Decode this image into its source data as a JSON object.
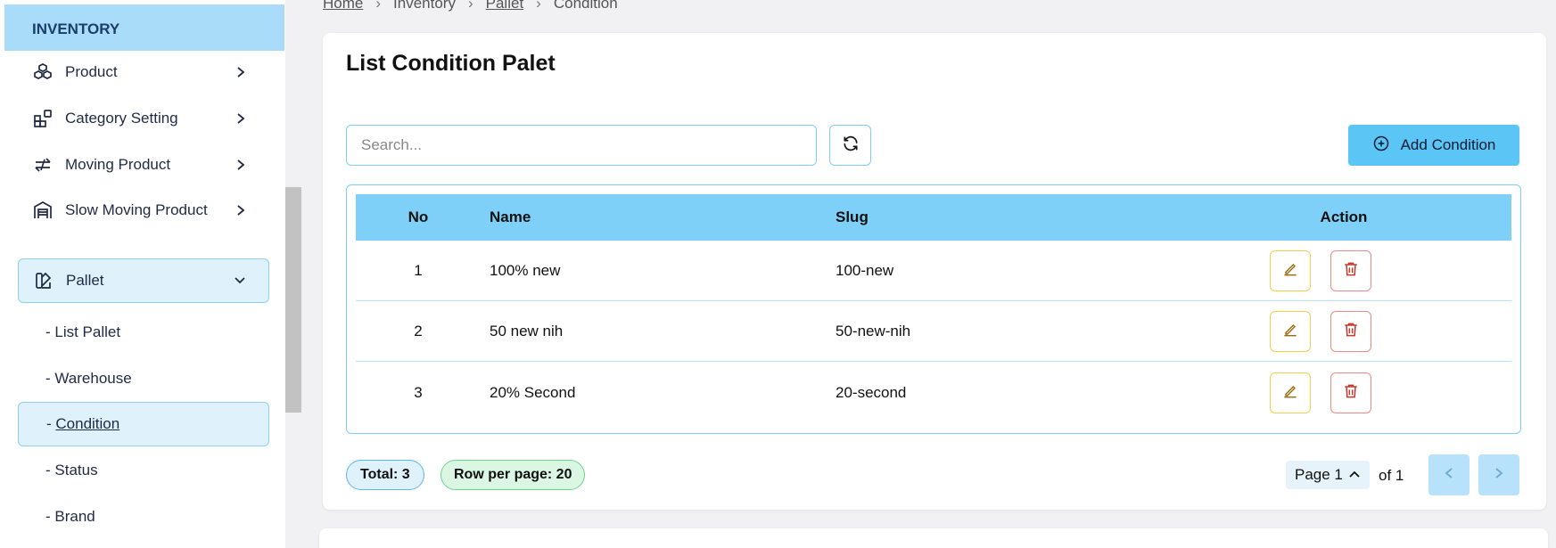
{
  "sidebar": {
    "section_title": "INVENTORY",
    "items": [
      {
        "label": "Product",
        "icon": "boxes-icon",
        "chevron": "chevron-right"
      },
      {
        "label": "Category Setting",
        "icon": "category-grid-icon",
        "chevron": "chevron-right"
      },
      {
        "label": "Moving Product",
        "icon": "arrows-exchange-icon",
        "chevron": "chevron-right"
      },
      {
        "label": "Slow Moving Product",
        "icon": "warehouse-icon",
        "chevron": "chevron-right"
      },
      {
        "label": "Pallet",
        "icon": "pallet-icon",
        "chevron": "chevron-down",
        "active": true
      }
    ],
    "subitems": [
      {
        "label": "- List Pallet"
      },
      {
        "label": "- Warehouse"
      },
      {
        "label": "Condition",
        "prefix": "- ",
        "active": true
      },
      {
        "label": "- Status"
      },
      {
        "label": "- Brand"
      }
    ]
  },
  "breadcrumb": [
    "Home",
    "Inventory",
    "Pallet",
    "Condition"
  ],
  "page": {
    "title": "List Condition Palet",
    "search_placeholder": "Search...",
    "add_button_label": "Add Condition"
  },
  "table": {
    "headers": {
      "no": "No",
      "name": "Name",
      "slug": "Slug",
      "action": "Action"
    },
    "rows": [
      {
        "no": "1",
        "name": "100% new",
        "slug": "100-new"
      },
      {
        "no": "2",
        "name": "50 new nih",
        "slug": "50-new-nih"
      },
      {
        "no": "3",
        "name": "20% Second",
        "slug": "20-second"
      }
    ]
  },
  "footer": {
    "total": "Total: 3",
    "rows_per_page": "Row per page: 20",
    "page_label": "Page 1",
    "page_of": "of 1"
  },
  "colors": {
    "accent": "#5bc5f5",
    "header_bg": "#7fd0f8",
    "sidebar_header": "#a8dcf8",
    "edit_border": "#f5cf4d",
    "delete_border": "#f08a8a"
  }
}
